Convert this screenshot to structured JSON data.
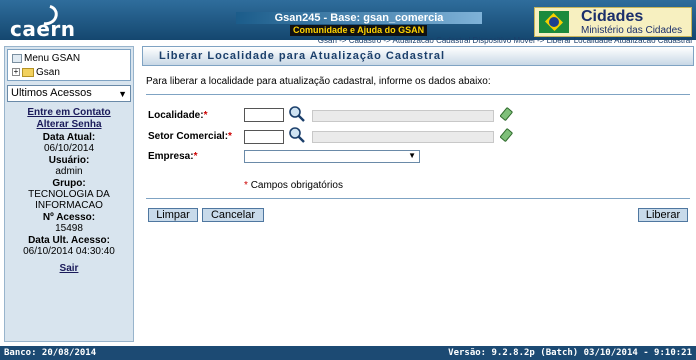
{
  "header": {
    "logo_text": "caern",
    "system_title": "Gsan245 - Base: gsan_comercia",
    "community_link": "Comunidade e Ajuda do GSAN",
    "ministry_title": "Cidades",
    "ministry_subtitle": "Ministério das Cidades",
    "breadcrumb": "Gsan -> Cadastro -> Atualizacao Cadastral Dispositivo Movel -> Liberar Localidade Atualizacao Cadastral"
  },
  "sidebar": {
    "menu_root": "Menu GSAN",
    "menu_child": "Gsan",
    "recent_select_value": "Ultimos Acessos",
    "contact_link": "Entre em Contato",
    "change_password_link": "Alterar Senha",
    "current_date_label": "Data Atual:",
    "current_date_value": "06/10/2014",
    "user_label": "Usuário:",
    "user_value": "admin",
    "group_label": "Grupo:",
    "group_value_line1": "TECNOLOGIA DA",
    "group_value_line2": "INFORMACAO",
    "access_count_label": "Nº Acesso:",
    "access_count_value": "15498",
    "last_access_label": "Data Ult. Acesso:",
    "last_access_value": "06/10/2014 04:30:40",
    "logout_link": "Sair"
  },
  "main": {
    "page_title": "Liberar Localidade para Atualização Cadastral",
    "instructions": "Para liberar a localidade para atualização cadastral, informe os dados abaixo:",
    "localidade_label": "Localidade:",
    "localidade_value": "",
    "setor_label": "Setor Comercial:",
    "setor_value": "",
    "empresa_label": "Empresa:",
    "empresa_value": "",
    "required_marker": "*",
    "required_note": "Campos obrigatórios",
    "clear_button": "Limpar",
    "cancel_button": "Cancelar",
    "release_button": "Liberar"
  },
  "footer": {
    "database_label": "Banco: 20/08/2014",
    "version_label": "Versão: 9.2.8.2p (Batch) 03/10/2014 - 9:10:21"
  },
  "colors": {
    "header_dark": "#14476f",
    "footer": "#1c4a73",
    "sidebar_bg": "#d8e4ee",
    "required": "#cc0000",
    "button_bg": "#c8daea"
  }
}
